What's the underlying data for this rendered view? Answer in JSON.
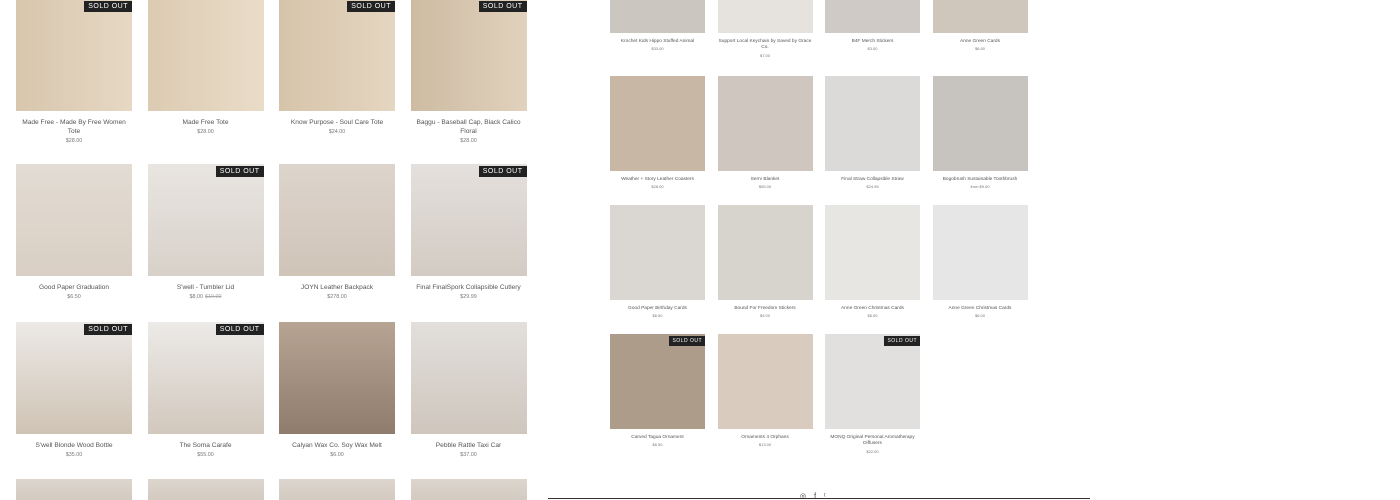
{
  "badge": "SOLD OUT",
  "colors": {
    "badge_bg": "#222222",
    "text": "#555555",
    "rule": "#333333"
  },
  "left_grid": [
    {
      "title": "Made Free - Made By Free Women Tote",
      "price": "$28.00",
      "sold_out": true
    },
    {
      "title": "Made Free Tote",
      "price": "$28.00",
      "sold_out": false
    },
    {
      "title": "Know Purpose - Soul Care Tote",
      "price": "$24.00",
      "sold_out": true
    },
    {
      "title": "Baggu - Baseball Cap, Black Calico Floral",
      "price": "$28.00",
      "sold_out": true
    },
    {
      "title": "Good Paper Graduation",
      "price": "$6.50",
      "sold_out": false
    },
    {
      "title": "S'well - Tumbler Lid",
      "price": "$8.00",
      "price_old": "$10.00",
      "sold_out": true
    },
    {
      "title": "JOYN Leather Backpack",
      "price": "$278.00",
      "sold_out": false
    },
    {
      "title": "Final FinalSpork Collapsible Cutlery",
      "price": "$29.99",
      "sold_out": true
    },
    {
      "title": "S'well Blonde Wood Bottle",
      "price": "$35.00",
      "sold_out": true
    },
    {
      "title": "The Soma Carafe",
      "price": "$55.00",
      "sold_out": true
    },
    {
      "title": "Calyan Wax Co. Soy Wax Melt",
      "price": "$6.00",
      "sold_out": false
    },
    {
      "title": "Pebble Rattle Taxi Car",
      "price": "$37.00",
      "sold_out": false
    }
  ],
  "right_grid": [
    {
      "title": "Krochet Kids Hippo Stuffed Animal",
      "price": "$33.00",
      "sold_out": false
    },
    {
      "title": "Support Local Keychain by Saved by Grace Co.",
      "price": "$7.00",
      "sold_out": false
    },
    {
      "title": "B4F Merch Stickers",
      "price": "$3.00",
      "sold_out": false
    },
    {
      "title": "Anne Green Cards",
      "price": "$6.50",
      "sold_out": false
    },
    {
      "title": "Weather + Story Leather Coasters",
      "price": "$28.00",
      "sold_out": false
    },
    {
      "title": "Serrv Blanket",
      "price": "$55.00",
      "sold_out": false
    },
    {
      "title": "Final Straw Collapsible Straw",
      "price": "$24.95",
      "sold_out": false
    },
    {
      "title": "Bogobrush Sustainable Toothbrush",
      "price": "from $9.50",
      "sold_out": false
    },
    {
      "title": "Good Paper Birthday Cards",
      "price": "$6.50",
      "sold_out": false
    },
    {
      "title": "Bound For Freedom Stickers",
      "price": "$3.00",
      "sold_out": false
    },
    {
      "title": "Anne Green Christmas Cards",
      "price": "$6.00",
      "sold_out": false
    },
    {
      "title": "Anne Green Christmas Cards",
      "price": "$6.00",
      "sold_out": false
    },
    {
      "title": "Carved Tagua Ornament",
      "price": "$6.50",
      "sold_out": true
    },
    {
      "title": "Ornaments 4 Orphans",
      "price": "$13.00",
      "sold_out": false
    },
    {
      "title": "MONQ Original Personal Aromatherapy Diffusers",
      "price": "$22.00",
      "sold_out": true
    }
  ],
  "footer": {
    "icons": [
      "instagram-icon",
      "facebook-icon",
      "twitter-icon"
    ]
  }
}
